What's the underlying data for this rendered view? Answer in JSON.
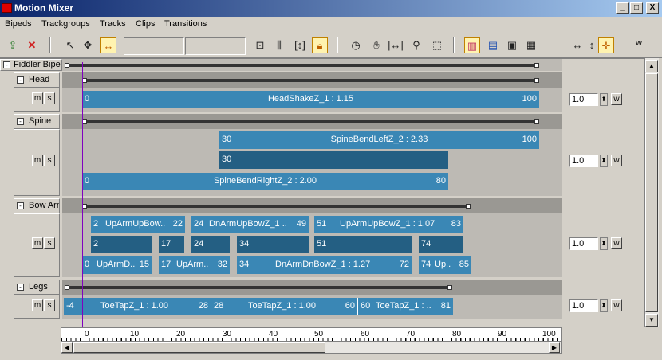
{
  "window": {
    "title": "Motion Mixer",
    "min": "_",
    "max": "□",
    "close": "X"
  },
  "menu": [
    "Bipeds",
    "Trackgroups",
    "Tracks",
    "Clips",
    "Transitions"
  ],
  "toolbar": {
    "w_label": "w"
  },
  "biped": {
    "name": "Fiddler Bipe"
  },
  "groups": [
    {
      "name": "Head",
      "m": "m",
      "s": "s",
      "weight": "1.0",
      "w": "w",
      "clips": [
        {
          "start": "0",
          "label": "HeadShakeZ_1 : 1.15",
          "end": "100"
        }
      ]
    },
    {
      "name": "Spine",
      "m": "m",
      "s": "s",
      "weight": "1.0",
      "w": "w",
      "clips": [
        {
          "start": "30",
          "label": "SpineBendLeftZ_2 : 2.33",
          "end": "100"
        },
        {
          "start": "30"
        },
        {
          "start": "0",
          "label": "SpineBendRightZ_2 : 2.00",
          "end": "80"
        }
      ]
    },
    {
      "name": "Bow Arm",
      "m": "m",
      "s": "s",
      "weight": "1.0",
      "w": "w",
      "clips": [
        {
          "start": "2",
          "label": "UpArmUpBow..",
          "end": "22"
        },
        {
          "start": "24",
          "label": "DnArmUpBowZ_1 ..",
          "end": "49"
        },
        {
          "start": "51",
          "label": "UpArmUpBowZ_1 : 1.07",
          "end": "83"
        },
        {
          "start": "2"
        },
        {
          "start": "17"
        },
        {
          "start": "24"
        },
        {
          "start": "34"
        },
        {
          "start": "51"
        },
        {
          "start": "74"
        },
        {
          "start": "0",
          "label": "UpArmD..",
          "end": "15"
        },
        {
          "start": "17",
          "label": "UpArm..",
          "end": "32"
        },
        {
          "start": "34",
          "label": "DnArmDnBowZ_1 : 1.27",
          "end": "72"
        },
        {
          "start": "74",
          "label": "Up..",
          "end": "85"
        }
      ]
    },
    {
      "name": "Legs",
      "m": "m",
      "s": "s",
      "weight": "1.0",
      "w": "w",
      "clips": [
        {
          "start": "-4",
          "label": "ToeTapZ_1 : 1.00",
          "end": "28"
        },
        {
          "start": "28",
          "label": "ToeTapZ_1 : 1.00",
          "end": "60"
        },
        {
          "start": "60",
          "label": "ToeTapZ_1 : ..",
          "end": "81"
        }
      ]
    }
  ],
  "ruler": [
    "0",
    "10",
    "20",
    "30",
    "40",
    "50",
    "60",
    "70",
    "80",
    "90",
    "100"
  ]
}
